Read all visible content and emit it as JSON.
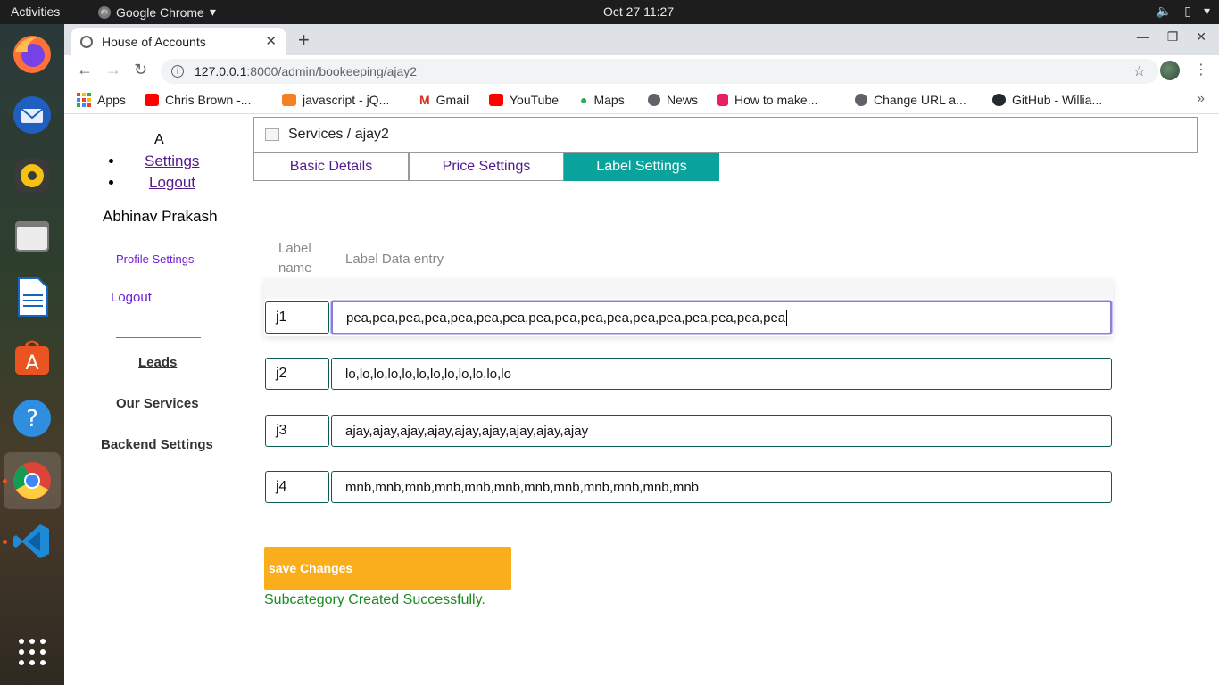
{
  "topbar": {
    "activities": "Activities",
    "app_name": "Google Chrome",
    "clock": "Oct 27  11:27"
  },
  "dock": {
    "items": [
      "firefox-icon",
      "thunderbird-icon",
      "rhythmbox-icon",
      "files-icon",
      "writer-icon",
      "software-icon",
      "help-icon",
      "chrome-icon",
      "vscode-icon",
      "app-grid-icon"
    ]
  },
  "browser": {
    "tab_title": "House of Accounts",
    "url_host": "127.0.0.1",
    "url_rest": ":8000/admin/bookeeping/ajay2",
    "bookmarks": [
      {
        "label": "Apps",
        "color": "#ea4335"
      },
      {
        "label": "Chris Brown -...",
        "color": "#ff0000"
      },
      {
        "label": "javascript - jQ...",
        "color": "#f48024"
      },
      {
        "label": "Gmail",
        "color": "#d93025"
      },
      {
        "label": "YouTube",
        "color": "#ff0000"
      },
      {
        "label": "Maps",
        "color": "#34a853"
      },
      {
        "label": "News",
        "color": "#5f6368"
      },
      {
        "label": "How to make...",
        "color": "#e91e63"
      },
      {
        "label": "Change URL a...",
        "color": "#5f6368"
      },
      {
        "label": "GitHub - Willia...",
        "color": "#24292e"
      }
    ]
  },
  "sidebar": {
    "avatar_letter": "A",
    "settings": "Settings",
    "logout_top": "Logout",
    "user_name": "Abhinav Prakash",
    "profile_settings": "Profile Settings",
    "logout": "Logout",
    "leads": "Leads",
    "our_services": "Our Services",
    "backend_settings": "Backend Settings"
  },
  "main": {
    "breadcrumb": "Services / ajay2",
    "tabs": [
      "Basic Details",
      "Price Settings",
      "Label Settings"
    ],
    "active_tab": "Label Settings",
    "col_label_name_1": "Label",
    "col_label_name_2": "name",
    "col_label_data": "Label Data entry",
    "rows": [
      {
        "label": "j1",
        "value": "pea,pea,pea,pea,pea,pea,pea,pea,pea,pea,pea,pea,pea,pea,pea,pea,pea"
      },
      {
        "label": "j2",
        "value": "lo,lo,lo,lo,lo,lo,lo,lo,lo,lo,lo,lo"
      },
      {
        "label": "j3",
        "value": "ajay,ajay,ajay,ajay,ajay,ajay,ajay,ajay,ajay"
      },
      {
        "label": "j4",
        "value": "mnb,mnb,mnb,mnb,mnb,mnb,mnb,mnb,mnb,mnb,mnb,mnb"
      }
    ],
    "save_button": "save Changes",
    "success_message": "Subcategory Created Successfully."
  },
  "colors": {
    "active_tab": "#0aa39b",
    "save_button": "#fbae1c",
    "success": "#1b8a22",
    "link_purple": "#6f1ed6"
  }
}
